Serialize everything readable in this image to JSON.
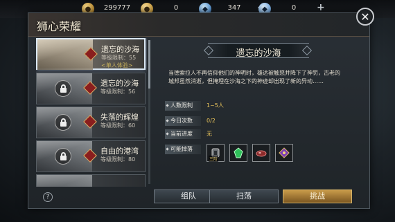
{
  "resources": [
    {
      "icon": "gold-coin-icon",
      "value": "299777"
    },
    {
      "icon": "potion-icon",
      "value": "0"
    },
    {
      "icon": "blue-gem-icon",
      "value": "347"
    },
    {
      "icon": "crystal-icon",
      "value": "0"
    }
  ],
  "resource_plus": "+",
  "panel": {
    "title": "狮心荣耀",
    "close": "✕"
  },
  "stages": [
    {
      "name": "遗忘的沙海",
      "level": "等级限制：55",
      "tag": "<单人体验>",
      "locked": false,
      "selected": true
    },
    {
      "name": "遗忘的沙海",
      "level": "等级限制：56",
      "locked": true
    },
    {
      "name": "失落的辉煌",
      "level": "等级限制：60",
      "locked": true
    },
    {
      "name": "自由的港湾",
      "level": "等级限制：80",
      "locked": true
    }
  ],
  "detail": {
    "title": "遗忘的沙海",
    "description": "当德索拉人不再信仰他们的神明时，雄达被触怒并降下了神罚，古老的城邦虽然消逝，但掩埋在沙海之下的神迹却出现了新的异动……",
    "rows": [
      {
        "label": "人数限制",
        "value": "1~5人"
      },
      {
        "label": "今日次数",
        "value": "0/2"
      },
      {
        "label": "当前进度",
        "value": "无"
      },
      {
        "label": "可能掉落",
        "value": ""
      }
    ],
    "drop_badge": "三阶"
  },
  "buttons": {
    "help": "?",
    "team": "组队",
    "sweep": "扫荡",
    "challenge": "挑战"
  }
}
